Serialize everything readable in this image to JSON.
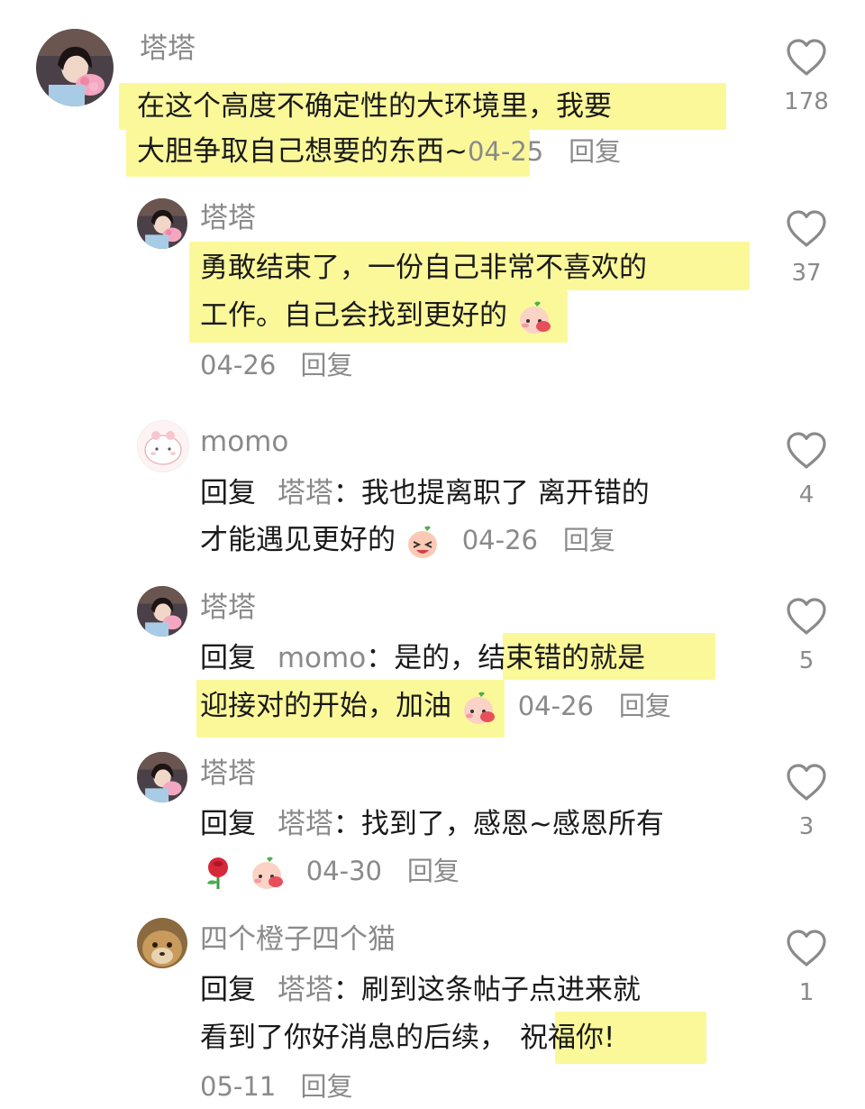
{
  "comments": [
    {
      "user": "塔塔",
      "text_lines": [
        "在这个高度不确定性的大环境里，我要",
        "大胆争取自己想要的东西~"
      ],
      "date": "04-25",
      "reply_label": "回复",
      "likes": "178"
    },
    {
      "user": "塔塔",
      "text_lines": [
        "勇敢结束了，一份自己非常不喜欢的",
        "工作。自己会找到更好的"
      ],
      "emoji": "blushing-peach-emoji",
      "date": "04-26",
      "reply_label": "回复",
      "likes": "37"
    },
    {
      "user": "momo",
      "reply_prefix": "回复",
      "reply_to": "塔塔",
      "colon": "：",
      "text_lines": [
        "我也提离职了 离开错的",
        "才能遇见更好的"
      ],
      "emoji": "laughing-peach-emoji",
      "date": "04-26",
      "reply_label": "回复",
      "likes": "4"
    },
    {
      "user": "塔塔",
      "reply_prefix": "回复",
      "reply_to": "momo",
      "colon": "：",
      "text_lines": [
        "是的，",
        "结束错的就是",
        "迎接对的开始，加油"
      ],
      "emoji": "blushing-peach-emoji",
      "date": "04-26",
      "reply_label": "回复",
      "likes": "5"
    },
    {
      "user": "塔塔",
      "reply_prefix": "回复",
      "reply_to": "塔塔",
      "colon": "：",
      "text_lines": [
        "找到了，感恩~感恩所有"
      ],
      "emojis": [
        "rose-emoji",
        "blushing-peach-emoji"
      ],
      "date": "04-30",
      "reply_label": "回复",
      "likes": "3"
    },
    {
      "user": "四个橙子四个猫",
      "reply_prefix": "回复",
      "reply_to": "塔塔",
      "colon": "：",
      "text_lines": [
        "刷到这条帖子点进来就",
        "看到了你好消息的后续，",
        "祝福你!"
      ],
      "date": "05-11",
      "reply_label": "回复",
      "likes": "1"
    }
  ],
  "colors": {
    "highlight": "#fbf89a",
    "muted_text": "#8a8a8a",
    "body_text": "#1a1a1a",
    "heart_stroke": "#8a8a8a"
  },
  "icons": {
    "like": "heart-outline-icon"
  }
}
